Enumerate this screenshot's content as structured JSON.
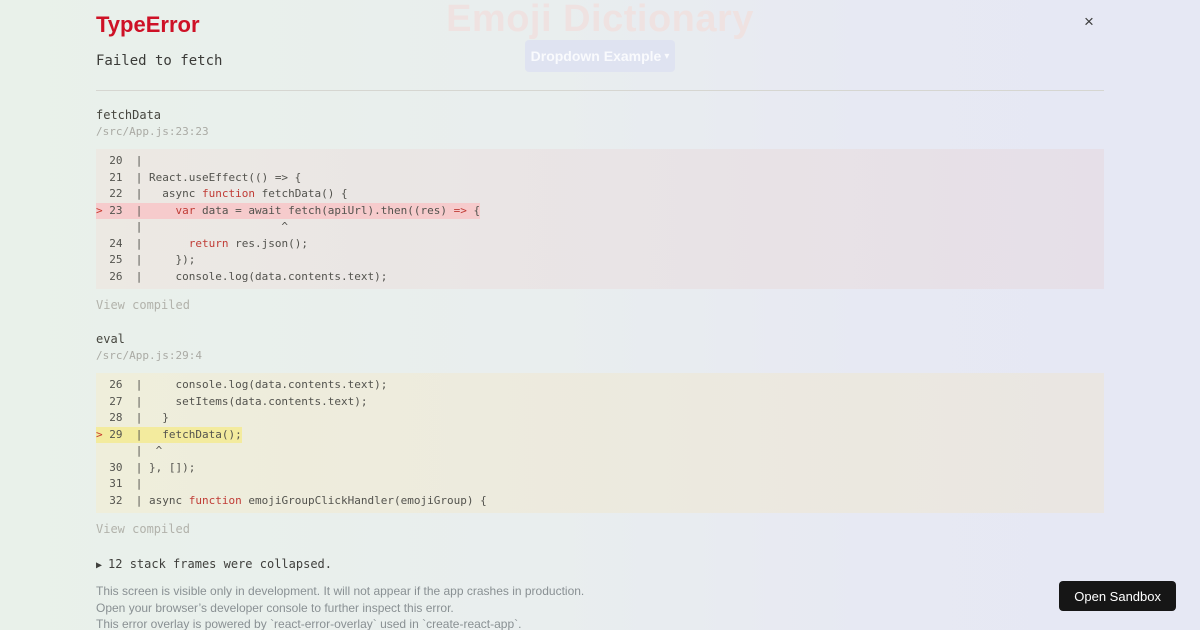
{
  "background": {
    "app_title": "Emoji Dictionary",
    "dropdown_label": "Dropdown Example",
    "dropdown_caret": "▾"
  },
  "overlay": {
    "close_glyph": "×",
    "error_type": "TypeError",
    "error_message": "Failed to fetch",
    "frames": [
      {
        "fn": "fetchData",
        "location": "/src/App.js:23:23",
        "variant": "red",
        "view_compiled_label": "View compiled",
        "lines": [
          {
            "num": "20",
            "segments": []
          },
          {
            "num": "21",
            "segments": [
              {
                "t": "React.useEffect(() => {",
                "c": "plain"
              }
            ]
          },
          {
            "num": "22",
            "segments": [
              {
                "t": "  async ",
                "c": "plain"
              },
              {
                "t": "function",
                "c": "kw"
              },
              {
                "t": " fetchData() {",
                "c": "plain"
              }
            ]
          },
          {
            "num": "23",
            "marker": true,
            "highlight": true,
            "segments": [
              {
                "t": "    ",
                "c": "plain"
              },
              {
                "t": "var",
                "c": "kw"
              },
              {
                "t": " data = await fetch(apiUrl).then((res) ",
                "c": "plain"
              },
              {
                "t": "=>",
                "c": "kw"
              },
              {
                "t": " {",
                "c": "plain"
              }
            ]
          },
          {
            "caret": true,
            "content": "                    ^"
          },
          {
            "num": "24",
            "segments": [
              {
                "t": "      ",
                "c": "plain"
              },
              {
                "t": "return",
                "c": "kw"
              },
              {
                "t": " res.json();",
                "c": "plain"
              }
            ]
          },
          {
            "num": "25",
            "segments": [
              {
                "t": "    });",
                "c": "plain"
              }
            ]
          },
          {
            "num": "26",
            "segments": [
              {
                "t": "    console.log(data.contents.text);",
                "c": "plain"
              }
            ]
          }
        ]
      },
      {
        "fn": "eval",
        "location": "/src/App.js:29:4",
        "variant": "yellow",
        "view_compiled_label": "View compiled",
        "lines": [
          {
            "num": "26",
            "segments": [
              {
                "t": "    console.log(data.contents.text);",
                "c": "plain"
              }
            ]
          },
          {
            "num": "27",
            "segments": [
              {
                "t": "    setItems(data.contents.text);",
                "c": "plain"
              }
            ]
          },
          {
            "num": "28",
            "segments": [
              {
                "t": "  }",
                "c": "plain"
              }
            ]
          },
          {
            "num": "29",
            "marker": true,
            "highlight": true,
            "segments": [
              {
                "t": "  fetchData();",
                "c": "plain"
              }
            ]
          },
          {
            "caret": true,
            "content": " ^"
          },
          {
            "num": "30",
            "segments": [
              {
                "t": "}, []);",
                "c": "plain"
              }
            ]
          },
          {
            "num": "31",
            "segments": []
          },
          {
            "num": "32",
            "segments": [
              {
                "t": "async ",
                "c": "plain"
              },
              {
                "t": "function",
                "c": "kw"
              },
              {
                "t": " emojiGroupClickHandler(emojiGroup) {",
                "c": "plain"
              }
            ]
          }
        ]
      }
    ],
    "collapsed_icon": "▶",
    "collapsed_text": "12 stack frames were collapsed.",
    "footer_lines": [
      "This screen is visible only in development. It will not appear if the app crashes in production.",
      "Open your browser’s developer console to further inspect this error.",
      "This error overlay is powered by `react-error-overlay` used in `create-react-app`."
    ]
  },
  "sandbox_button_label": "Open Sandbox",
  "colors": {
    "error_red": "#ce1126",
    "keyword_red": "#c03c36",
    "highlight_red": "#f6cbcc",
    "highlight_yellow": "#f3eb9e",
    "sandbox_button_bg": "#161616"
  }
}
